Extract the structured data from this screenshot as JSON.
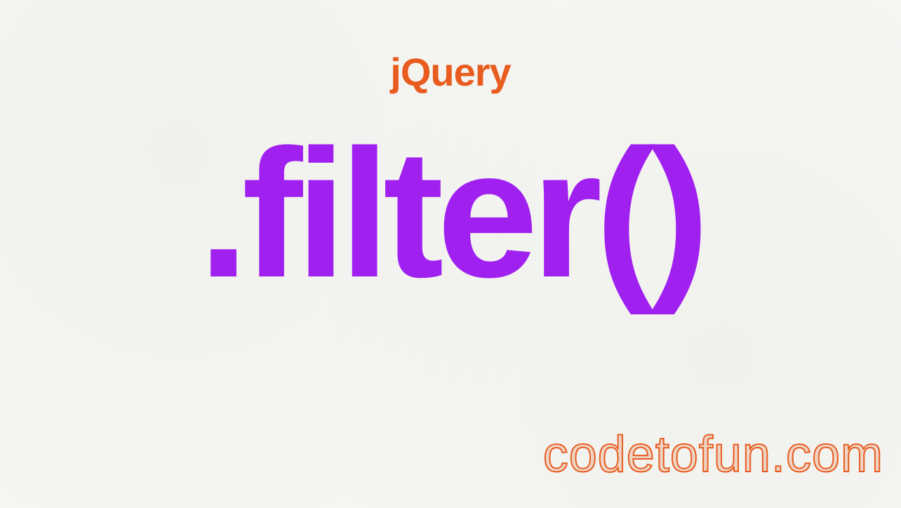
{
  "header": {
    "library_name": "jQuery"
  },
  "main": {
    "method_name": ".filter()"
  },
  "footer": {
    "website": "codetofun.com"
  }
}
